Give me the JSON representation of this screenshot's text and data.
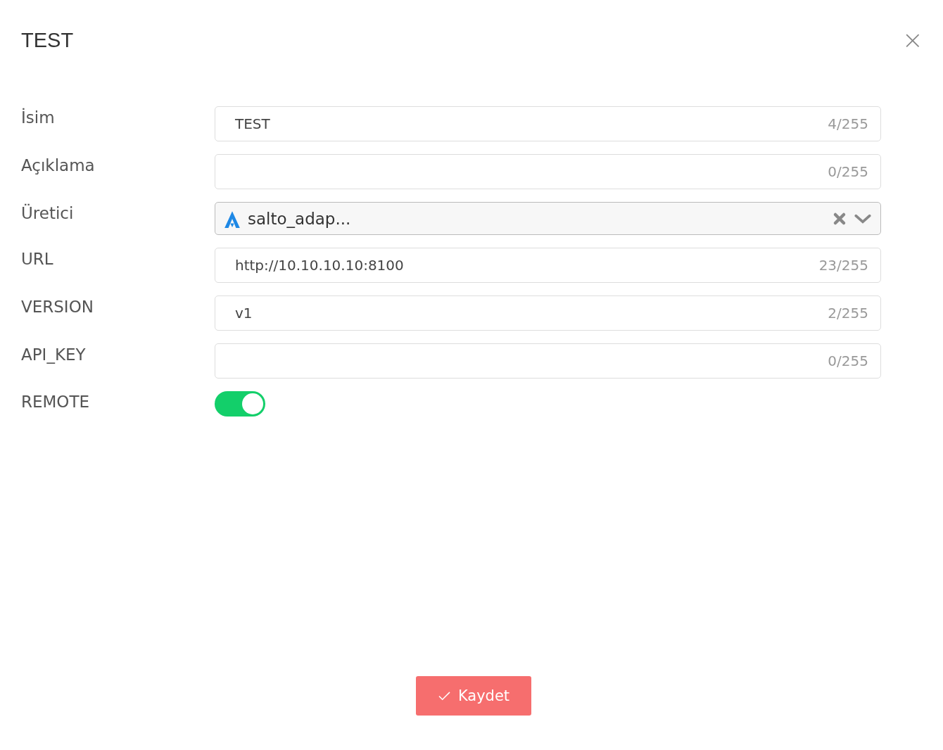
{
  "dialog": {
    "title": "TEST",
    "close_icon": "×"
  },
  "fields": [
    {
      "kind": "text",
      "label": "İsim",
      "value": "TEST",
      "counter": "4/255"
    },
    {
      "kind": "text",
      "label": "Açıklama",
      "counter": "0/255"
    },
    {
      "kind": "select",
      "label": "Üretici",
      "value": "salto_adap..."
    },
    {
      "kind": "text",
      "label": "URL",
      "value": "http://10.10.10.10:8100",
      "counter": "23/255"
    },
    {
      "kind": "text",
      "label": "VERSION",
      "value": "v1",
      "counter": "2/255"
    },
    {
      "kind": "text",
      "label": "API_KEY",
      "counter": "0/255"
    },
    {
      "kind": "toggle",
      "label": "REMOTE",
      "on": true
    }
  ],
  "save_button": {
    "label": "Kaydet"
  }
}
